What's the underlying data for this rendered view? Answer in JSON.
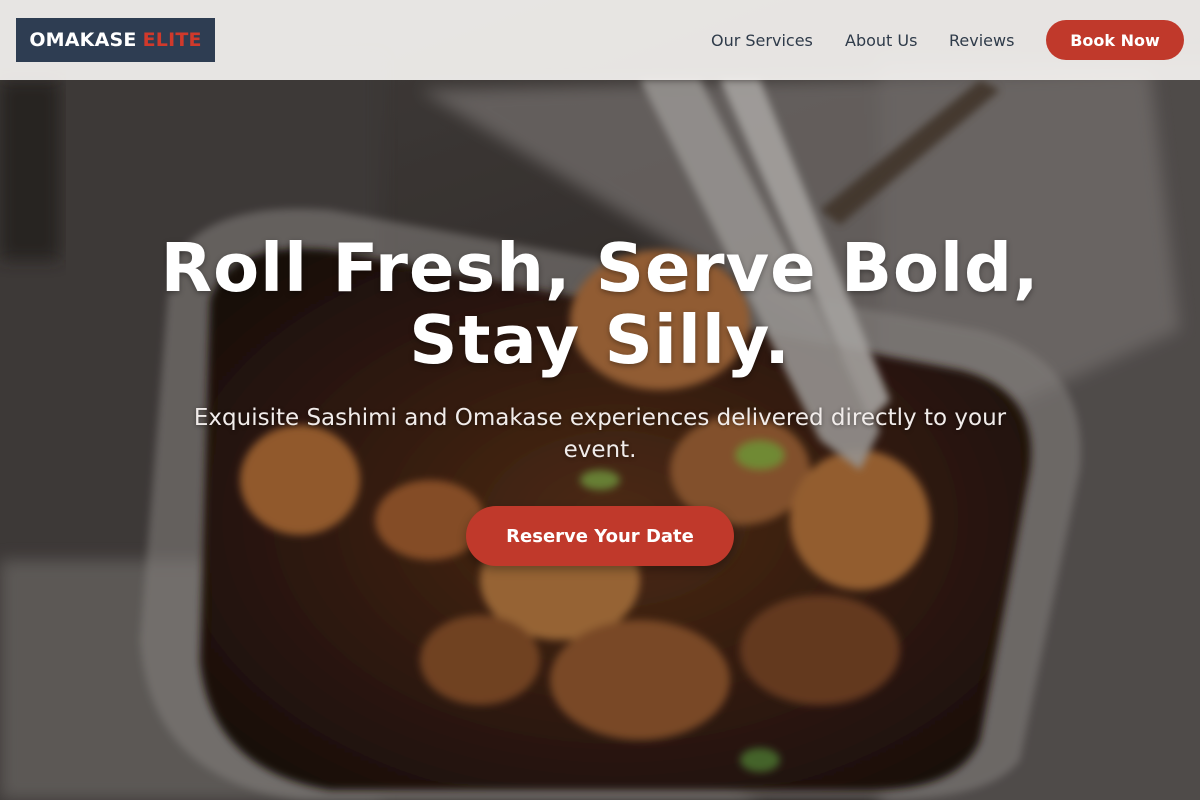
{
  "brand": {
    "name_primary": "OMAKASE",
    "name_accent": "ELITE",
    "colors": {
      "navy": "#2e3d52",
      "red": "#c0392b"
    }
  },
  "nav": {
    "items": [
      {
        "label": "Our Services"
      },
      {
        "label": "About Us"
      },
      {
        "label": "Reviews"
      }
    ],
    "cta_label": "Book Now"
  },
  "hero": {
    "headline": "Roll Fresh, Serve Bold, Stay Silly.",
    "subheadline": "Exquisite Sashimi and Omakase experiences delivered directly to your event.",
    "cta_label": "Reserve Your Date",
    "background_image": "food tray with glazed shrimp and tongs"
  }
}
